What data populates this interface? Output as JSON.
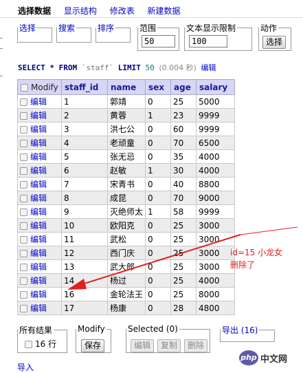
{
  "tabs": [
    "选择数据",
    "显示结构",
    "修改表",
    "新建数据"
  ],
  "filters": {
    "select_label": "选择",
    "search_label": "搜索",
    "sort_label": "排序",
    "range_legend": "范围",
    "range_value": "50",
    "text_limit_legend": "文本显示限制",
    "text_limit_value": "100",
    "action_legend": "动作",
    "action_button": "选择"
  },
  "sql": {
    "kw_select": "SELECT * FROM",
    "table": "`staff`",
    "kw_limit": "LIMIT",
    "limit": "50",
    "time": "(0.004 秒)",
    "edit": "编辑"
  },
  "table": {
    "columns": [
      "Modify",
      "staff_id",
      "name",
      "sex",
      "age",
      "salary"
    ],
    "edit_label": "编辑",
    "rows": [
      [
        "1",
        "郭靖",
        "0",
        "25",
        "5000"
      ],
      [
        "2",
        "黄蓉",
        "1",
        "23",
        "9999"
      ],
      [
        "3",
        "洪七公",
        "0",
        "60",
        "9999"
      ],
      [
        "4",
        "老顽童",
        "0",
        "70",
        "6500"
      ],
      [
        "5",
        "张无忌",
        "0",
        "35",
        "4000"
      ],
      [
        "6",
        "赵敏",
        "1",
        "30",
        "4000"
      ],
      [
        "7",
        "宋青书",
        "0",
        "40",
        "8800"
      ],
      [
        "8",
        "成昆",
        "0",
        "70",
        "9000"
      ],
      [
        "9",
        "灭绝师太",
        "1",
        "58",
        "9999"
      ],
      [
        "10",
        "欧阳克",
        "0",
        "25",
        "3000"
      ],
      [
        "11",
        "武松",
        "0",
        "25",
        "3000"
      ],
      [
        "12",
        "西门庆",
        "0",
        "25",
        "3000"
      ],
      [
        "13",
        "武大郎",
        "0",
        "25",
        "3000"
      ],
      [
        "14",
        "杨过",
        "0",
        "25",
        "4000"
      ],
      [
        "16",
        "金轮法王",
        "0",
        "25",
        "8000"
      ],
      [
        "17",
        "杨康",
        "0",
        "28",
        "4800"
      ]
    ]
  },
  "annotation": {
    "line1": "id=15  小龙女",
    "line2": "删除了",
    "color": "#e02020"
  },
  "footer": {
    "all_results_legend": "所有结果",
    "rows_label": "16 行",
    "modify_legend": "Modify",
    "save_button": "保存",
    "selected_legend": "Selected (0)",
    "edit_button": "编辑",
    "copy_button": "复制",
    "delete_button": "删除",
    "export_link": "导出 (16)",
    "import_link": "导入"
  },
  "watermark": {
    "logo": "php",
    "text": "中文网"
  }
}
